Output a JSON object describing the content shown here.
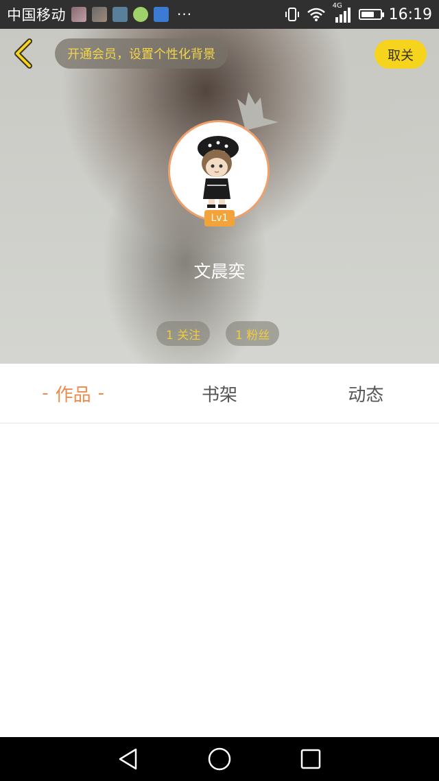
{
  "status_bar": {
    "carrier": "中国移动",
    "more": "···",
    "network": "4G",
    "time": "16:19",
    "battery_level": 0.7
  },
  "header": {
    "back_icon": "chevron-left-icon",
    "vip_banner": "开通会员，设置个性化背景",
    "follow_label": "取关",
    "accent_color": "#f6d31c"
  },
  "profile": {
    "level": "Lv1",
    "username": "文晨奕",
    "following": "1 关注",
    "fans": "1 粉丝"
  },
  "tabs": [
    {
      "label": "作品",
      "active": true
    },
    {
      "label": "书架",
      "active": false
    },
    {
      "label": "动态",
      "active": false
    }
  ],
  "tab_dash": "-",
  "colors": {
    "active_tab": "#ef8a4c",
    "badge": "#f2a43a"
  },
  "nav": [
    "back-triangle-icon",
    "home-circle-icon",
    "recents-square-icon"
  ]
}
